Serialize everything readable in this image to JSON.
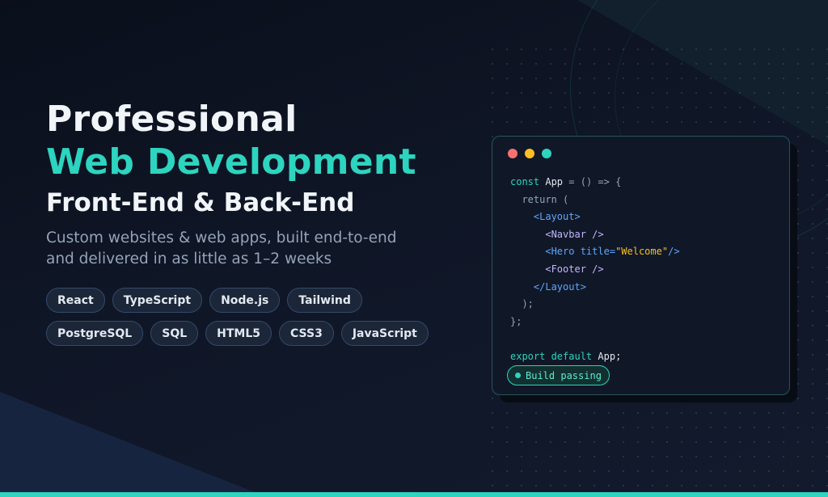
{
  "hero": {
    "title_line1": "Professional",
    "title_line2": "Web Development",
    "title_line3": "Front-End & Back-End",
    "subtitle_line1": "Custom websites & web apps, built end-to-end",
    "subtitle_line2": "and delivered in as little as 1–2 weeks"
  },
  "tags": {
    "row1": [
      "React",
      "TypeScript",
      "Node.js",
      "Tailwind"
    ],
    "row2": [
      "PostgreSQL",
      "SQL",
      "HTML5",
      "CSS3",
      "JavaScript"
    ]
  },
  "code_window": {
    "lines": {
      "l1_kw": "const",
      "l1_id": "App",
      "l1_rest": "= () => {",
      "l2": "return (",
      "l3": "<Layout>",
      "l4": "<Navbar />",
      "l5_tag": "<Hero title=",
      "l5_str": "\"Welcome\"",
      "l5_end": "/>",
      "l6": "<Footer />",
      "l7": "</Layout>",
      "l8": ");",
      "l9": "};",
      "l11_kw": "export default",
      "l11_id": "App;"
    },
    "status_badge": "Build passing"
  },
  "colors": {
    "accent": "#2dd4bf",
    "background": "#0e1422",
    "window_red": "#f87171",
    "window_yellow": "#fbbf24",
    "window_green": "#2dd4bf"
  },
  "icons": [
    "window-close-dot-icon",
    "window-minimize-dot-icon",
    "window-maximize-dot-icon",
    "status-dot-icon"
  ]
}
